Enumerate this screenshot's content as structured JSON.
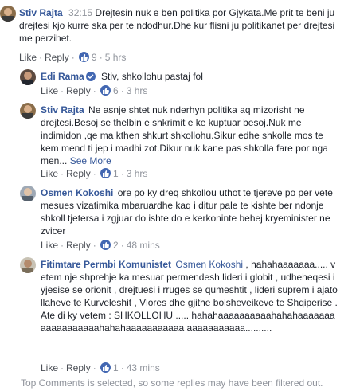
{
  "comments": [
    {
      "author": "Stiv Rajta",
      "timestamp": "32:15",
      "text": "Drejtesin nuk e ben politika por Gjykata.Me prit te beni ju drejtesi kjo kurre ska per te ndodhur.Dhe kur flisni ju politikanet per drejtesi me perzihet.",
      "like_label": "Like",
      "reply_label": "Reply",
      "like_count": "9",
      "age": "5 hrs",
      "avatar_icon": "user-photo-icon"
    },
    {
      "author": "Edi Rama",
      "verified": true,
      "text": "Stiv, shkollohu pastaj fol",
      "like_label": "Like",
      "reply_label": "Reply",
      "like_count": "6",
      "age": "3 hrs",
      "avatar_icon": "user-photo-icon"
    },
    {
      "author": "Stiv Rajta",
      "text": "Ne asnje shtet nuk nderhyn politika aq mizorisht ne drejtesi.Besoj se thelbin e shkrimit e ke kuptuar besoj.Nuk me indimidon ,qe ma kthen shkurt shkollohu.Sikur edhe shkolle mos te kem mend ti jep i madhi zot.Dikur nuk kane pas shkolla fare por nga men...",
      "see_more": "See More",
      "like_label": "Like",
      "reply_label": "Reply",
      "like_count": "1",
      "age": "3 hrs",
      "avatar_icon": "user-photo-icon"
    },
    {
      "author": "Osmen Kokoshi",
      "text": "ore po ky dreq shkollou uthot te tjereve po per vete mesues vizatimika mbaruardhe kaq i ditur pale te kishte ber ndonje shkoll tjetersa i zgjuar do ishte do e kerkoninte behej kryeminister ne zvicer",
      "like_label": "Like",
      "reply_label": "Reply",
      "like_count": "2",
      "age": "48 mins",
      "avatar_icon": "user-photo-icon"
    },
    {
      "author": "Fitimtare Permbi Komunistet",
      "mention": "Osmen Kokoshi",
      "text": ", hahahaaaaaaa..... vetem nje shprehje ka mesuar permendesh lideri i globit , udheheqesi i yjesise se orionit , drejtuesi i rruges se qumeshtit , lideri suprem i ajatollaheve te Kurveleshit , Vlores dhe gjithe bolsheveikeve te Shqiperise . Ate di ky vetem : SHKOLLOHU ..... hahahaaaaaaaaaahahahaaaaaaaaaaaaaaaaaahahahaaaaaaaaaaa aaaaaaaaaaa..........",
      "like_label": "Like",
      "reply_label": "Reply",
      "like_count": "1",
      "age": "43 mins",
      "avatar_icon": "user-photo-icon"
    }
  ],
  "footer_note": "Top Comments is selected, so some replies may have been filtered out.",
  "colors": {
    "author": "#365899",
    "meta": "#90949c",
    "like_badge": "#4267b2",
    "text": "#1d2129"
  },
  "icons": {
    "like": "thumbs-up-icon",
    "verified": "verified-badge-icon"
  }
}
